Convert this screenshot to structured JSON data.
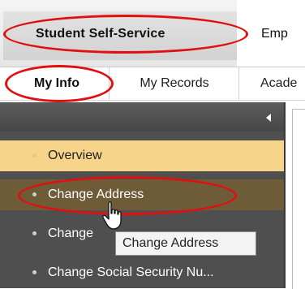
{
  "top_tabs": [
    {
      "label": "Student Self-Service",
      "active": true
    },
    {
      "label": "Emp"
    }
  ],
  "sub_tabs": [
    {
      "label": "My Info",
      "active": true
    },
    {
      "label": "My Records"
    },
    {
      "label": "Acade"
    }
  ],
  "sidebar": {
    "collapse_icon": "chevron-left-icon",
    "items": [
      {
        "label": "Overview",
        "state": "selected"
      },
      {
        "label": "Change Address",
        "state": "hover"
      },
      {
        "label": "Change"
      },
      {
        "label": "Change Social Security Nu..."
      }
    ]
  },
  "tooltip": {
    "text": "Change Address"
  },
  "colors": {
    "highlight_oval": "#e01010",
    "selected_item": "#f6d58b",
    "hover_item": "#6e5b37",
    "sidebar_bg": "#4f4f4f"
  }
}
